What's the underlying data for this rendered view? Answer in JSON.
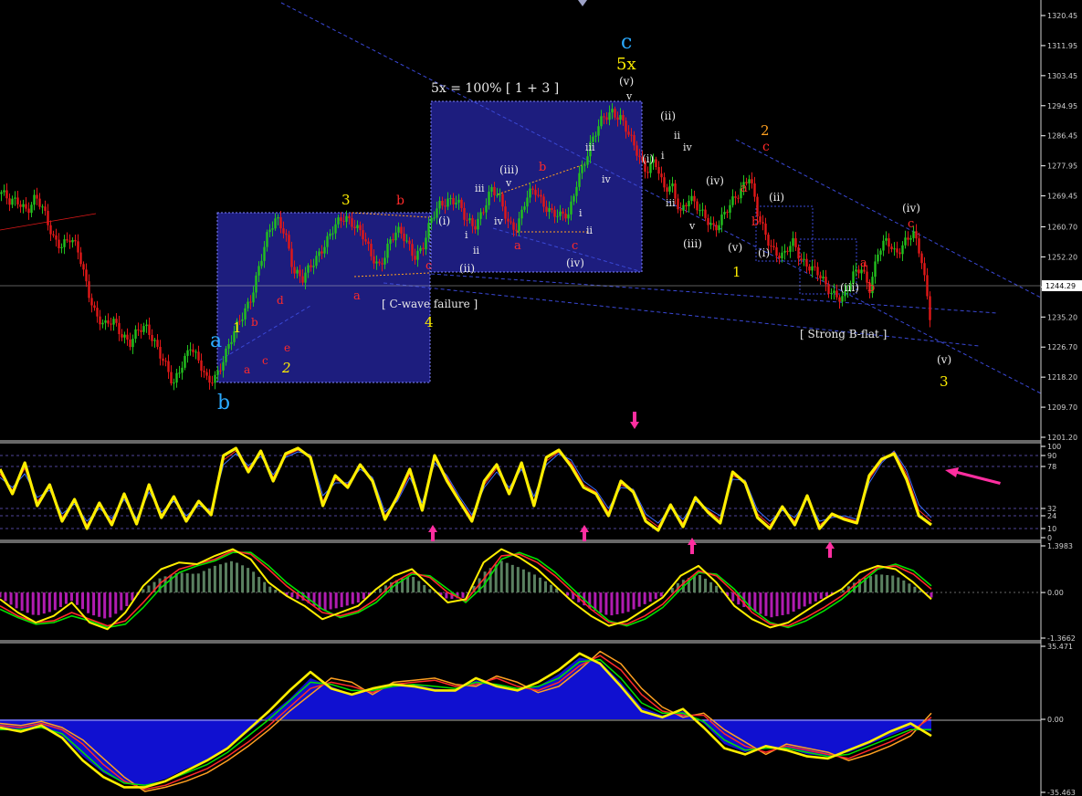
{
  "colors": {
    "background": "#000000",
    "bull": "#22c01e",
    "bear": "#e01818",
    "box_fill": "#1d1d7e",
    "box_border": "#7f84ff",
    "trendline": "#3a48d6",
    "yellow": "#ffee00",
    "orange": "#ffa020",
    "red": "#ff2a2a",
    "white": "#e8e8e8",
    "cyan": "#2aaaff",
    "magenta": "#ff2ea0",
    "purple": "#b01cb0",
    "olive_hist": "#5a8060",
    "blue_fill": "#1010d0",
    "green": "#00e000",
    "axis": "#ffffff"
  },
  "chart_data": [
    {
      "type": "candlestick",
      "panel": "price",
      "ylim": [
        1201.2,
        1320.45
      ],
      "yticks": [
        "1320.45",
        "1311.95",
        "1303.45",
        "1294.95",
        "1286.45",
        "1277.95",
        "1269.45",
        "1260.70",
        "1252.20",
        "1243.70",
        "1235.20",
        "1226.70",
        "1218.20",
        "1209.70",
        "1201.20"
      ],
      "current_price": "1244.29",
      "close_path": [
        1270.5,
        1267,
        1268,
        1266,
        1269,
        1264,
        1258,
        1256,
        1257,
        1253,
        1244,
        1236,
        1232,
        1234,
        1231,
        1228,
        1231,
        1232,
        1228,
        1222,
        1215,
        1222,
        1228,
        1222,
        1216,
        1219,
        1225,
        1230,
        1235,
        1241,
        1250,
        1258,
        1263,
        1260,
        1248,
        1245,
        1250,
        1254,
        1257,
        1261,
        1264,
        1262,
        1258,
        1252,
        1250,
        1256,
        1259,
        1257,
        1253,
        1255,
        1262,
        1267,
        1269,
        1268,
        1262,
        1261,
        1266,
        1271,
        1268,
        1262,
        1261,
        1268,
        1271,
        1268,
        1265,
        1263,
        1264,
        1275,
        1280,
        1286,
        1292,
        1294,
        1291,
        1286,
        1282,
        1277,
        1279,
        1271,
        1273,
        1265,
        1268,
        1266,
        1264,
        1260,
        1263,
        1268,
        1272,
        1275,
        1263,
        1258,
        1254,
        1252,
        1256,
        1252,
        1250,
        1247,
        1243,
        1242,
        1241,
        1246,
        1249,
        1244,
        1254,
        1256,
        1253,
        1257,
        1259,
        1251,
        1236
      ]
    },
    {
      "type": "line",
      "panel": "stochastic",
      "ylim": [
        0,
        100
      ],
      "yticks": [
        "100",
        "90",
        "78",
        "32",
        "24",
        "10",
        "0"
      ],
      "series": [
        {
          "color": "yellow",
          "values": [
            75,
            48,
            82,
            35,
            58,
            18,
            42,
            10,
            38,
            14,
            48,
            15,
            58,
            22,
            45,
            18,
            40,
            25,
            90,
            98,
            72,
            95,
            62,
            92,
            98,
            88,
            35,
            68,
            55,
            80,
            62,
            20,
            45,
            75,
            30,
            90,
            62,
            40,
            18,
            62,
            80,
            48,
            82,
            35,
            88,
            96,
            78,
            55,
            48,
            24,
            62,
            50,
            18,
            8,
            36,
            12,
            44,
            28,
            16,
            72,
            60,
            22,
            10,
            34,
            14,
            46,
            10,
            26,
            20,
            16,
            68,
            86,
            92,
            64,
            24,
            14
          ]
        },
        {
          "color": "red",
          "values": [
            70,
            52,
            76,
            40,
            55,
            22,
            40,
            14,
            35,
            18,
            45,
            18,
            54,
            25,
            43,
            21,
            38,
            28,
            85,
            95,
            76,
            92,
            66,
            90,
            96,
            90,
            40,
            64,
            58,
            78,
            64,
            24,
            42,
            70,
            34,
            86,
            66,
            42,
            22,
            58,
            76,
            52,
            78,
            40,
            84,
            94,
            82,
            58,
            50,
            28,
            58,
            52,
            22,
            12,
            34,
            16,
            42,
            30,
            20,
            68,
            62,
            26,
            14,
            32,
            18,
            44,
            14,
            24,
            22,
            18,
            64,
            84,
            94,
            70,
            30,
            18
          ]
        },
        {
          "color": "blue",
          "values": [
            66,
            55,
            70,
            44,
            52,
            26,
            37,
            18,
            32,
            21,
            42,
            21,
            50,
            28,
            40,
            24,
            35,
            30,
            80,
            92,
            79,
            89,
            69,
            88,
            94,
            91,
            46,
            60,
            60,
            75,
            66,
            28,
            40,
            66,
            38,
            82,
            68,
            45,
            25,
            55,
            72,
            55,
            75,
            45,
            80,
            92,
            85,
            62,
            52,
            32,
            55,
            53,
            26,
            16,
            32,
            20,
            40,
            32,
            24,
            64,
            63,
            30,
            18,
            30,
            22,
            42,
            18,
            22,
            24,
            20,
            60,
            82,
            95,
            74,
            36,
            22
          ]
        }
      ]
    },
    {
      "type": "histogram_lines",
      "panel": "macd",
      "ylim": [
        -1.3662,
        1.3983
      ],
      "yticks": [
        "1.3983",
        "0.00",
        "-1.3662"
      ],
      "histogram": [
        -0.15,
        -0.5,
        -0.7,
        -0.55,
        -0.25,
        -0.65,
        -0.8,
        -0.45,
        0.1,
        0.45,
        0.6,
        0.55,
        0.8,
        0.95,
        0.7,
        0.2,
        -0.1,
        -0.25,
        -0.55,
        -0.45,
        -0.3,
        0.05,
        0.35,
        0.5,
        0.1,
        -0.2,
        -0.15,
        0.6,
        0.95,
        0.75,
        0.5,
        0.15,
        -0.2,
        -0.5,
        -0.7,
        -0.6,
        -0.35,
        -0.1,
        0.35,
        0.55,
        0.2,
        -0.3,
        -0.55,
        -0.75,
        -0.65,
        -0.4,
        -0.15,
        0.05,
        0.4,
        0.55,
        0.5,
        0.2,
        -0.15
      ],
      "series": [
        {
          "color": "yellow",
          "values": [
            -0.2,
            -0.6,
            -0.9,
            -0.7,
            -0.3,
            -0.9,
            -1.1,
            -0.6,
            0.2,
            0.7,
            0.9,
            0.85,
            1.1,
            1.3,
            1.0,
            0.3,
            -0.1,
            -0.4,
            -0.8,
            -0.6,
            -0.4,
            0.1,
            0.5,
            0.7,
            0.2,
            -0.3,
            -0.2,
            0.9,
            1.3,
            1.05,
            0.7,
            0.2,
            -0.3,
            -0.7,
            -1.0,
            -0.85,
            -0.5,
            -0.15,
            0.5,
            0.8,
            0.3,
            -0.4,
            -0.8,
            -1.05,
            -0.9,
            -0.55,
            -0.2,
            0.1,
            0.6,
            0.8,
            0.7,
            0.3,
            -0.2
          ]
        },
        {
          "color": "red",
          "values": [
            -0.4,
            -0.7,
            -0.9,
            -0.85,
            -0.6,
            -0.8,
            -1.0,
            -0.85,
            -0.3,
            0.3,
            0.7,
            0.85,
            1.0,
            1.25,
            1.15,
            0.7,
            0.2,
            -0.2,
            -0.6,
            -0.7,
            -0.55,
            -0.2,
            0.3,
            0.6,
            0.45,
            0.0,
            -0.25,
            0.4,
            1.1,
            1.15,
            0.9,
            0.5,
            0.0,
            -0.5,
            -0.9,
            -0.95,
            -0.7,
            -0.35,
            0.2,
            0.65,
            0.5,
            0.0,
            -0.6,
            -0.95,
            -1.0,
            -0.75,
            -0.45,
            -0.1,
            0.35,
            0.75,
            0.8,
            0.55,
            0.1
          ]
        },
        {
          "color": "green",
          "values": [
            -0.5,
            -0.75,
            -0.95,
            -0.9,
            -0.7,
            -0.85,
            -1.05,
            -0.95,
            -0.45,
            0.15,
            0.6,
            0.8,
            0.95,
            1.2,
            1.2,
            0.8,
            0.3,
            -0.1,
            -0.5,
            -0.75,
            -0.6,
            -0.3,
            0.2,
            0.55,
            0.5,
            0.1,
            -0.3,
            0.2,
            1.0,
            1.2,
            1.0,
            0.6,
            0.1,
            -0.4,
            -0.85,
            -1.0,
            -0.8,
            -0.45,
            0.1,
            0.6,
            0.55,
            0.1,
            -0.5,
            -0.9,
            -1.05,
            -0.85,
            -0.55,
            -0.2,
            0.25,
            0.7,
            0.85,
            0.65,
            0.2
          ]
        }
      ]
    },
    {
      "type": "area_lines",
      "panel": "oscillator",
      "ylim": [
        -35.463,
        35.471
      ],
      "yticks": [
        "35.471",
        "0.00",
        "-35.463"
      ],
      "area": [
        -4,
        -5,
        -3,
        -8,
        -18,
        -26,
        -31,
        -32,
        -29,
        -24,
        -20,
        -14,
        -6,
        2,
        10,
        20,
        16,
        12,
        14,
        16,
        17,
        15,
        14,
        19,
        17,
        14,
        16,
        22,
        30,
        28,
        18,
        6,
        2,
        4,
        -2,
        -12,
        -16,
        -13,
        -14,
        -17,
        -18,
        -16,
        -12,
        -8,
        -4,
        -6
      ],
      "series": [
        {
          "color": "yellow",
          "values": [
            -4,
            -6,
            -3,
            -9,
            -20,
            -28,
            -33,
            -33,
            -30,
            -25,
            -20,
            -14,
            -5,
            4,
            14,
            23,
            15,
            12,
            15,
            17,
            16,
            14,
            14,
            20,
            16,
            14,
            18,
            24,
            32,
            27,
            16,
            4,
            1,
            5,
            -4,
            -14,
            -17,
            -13,
            -15,
            -18,
            -19,
            -15,
            -11,
            -6,
            -2,
            -8
          ]
        },
        {
          "color": "green",
          "values": [
            -5,
            -5,
            -4,
            -7,
            -16,
            -25,
            -31,
            -32,
            -30,
            -26,
            -22,
            -16,
            -8,
            0,
            9,
            18,
            17,
            14,
            14,
            16,
            17,
            16,
            15,
            18,
            17,
            15,
            16,
            20,
            28,
            29,
            20,
            8,
            3,
            3,
            -1,
            -10,
            -15,
            -14,
            -14,
            -16,
            -18,
            -17,
            -13,
            -9,
            -5,
            -5
          ]
        },
        {
          "color": "red",
          "values": [
            -3,
            -4,
            -2,
            -5,
            -12,
            -22,
            -30,
            -34,
            -32,
            -28,
            -24,
            -18,
            -11,
            -3,
            6,
            15,
            18,
            16,
            13,
            17,
            18,
            19,
            16,
            17,
            20,
            16,
            14,
            18,
            26,
            31,
            24,
            12,
            4,
            2,
            2,
            -7,
            -13,
            -16,
            -13,
            -15,
            -17,
            -19,
            -15,
            -11,
            -6,
            1
          ]
        },
        {
          "color": "orange",
          "values": [
            -2,
            -3,
            -1,
            -4,
            -10,
            -19,
            -28,
            -35,
            -33,
            -30,
            -26,
            -20,
            -13,
            -5,
            4,
            12,
            20,
            18,
            12,
            18,
            19,
            20,
            17,
            16,
            21,
            18,
            13,
            16,
            24,
            33,
            27,
            15,
            6,
            1,
            3,
            -5,
            -11,
            -17,
            -12,
            -14,
            -16,
            -20,
            -17,
            -13,
            -8,
            3
          ]
        }
      ]
    }
  ],
  "annotations": {
    "wave_a": "a",
    "wave_b": "b",
    "wave_c": "c",
    "wave_5x": "5x",
    "formula": "5x = 100% [ 1 + 3 ]",
    "c_wave_failure": "[ C-wave failure ]",
    "strong_b_flat": "[ Strong B-flat ]",
    "w1": "1",
    "w2": "2",
    "w3": "3",
    "w4": "4",
    "roman_i": "(i)",
    "roman_ii": "(ii)",
    "roman_iii": "(iii)",
    "roman_iv": "(iv)",
    "roman_v": "(v)",
    "small_i": "i",
    "small_ii": "ii",
    "small_iii": "iii",
    "small_iv": "iv",
    "small_v": "v",
    "sub_a": "a",
    "sub_b": "b",
    "sub_c": "c",
    "sub_d": "d",
    "sub_e": "e"
  }
}
